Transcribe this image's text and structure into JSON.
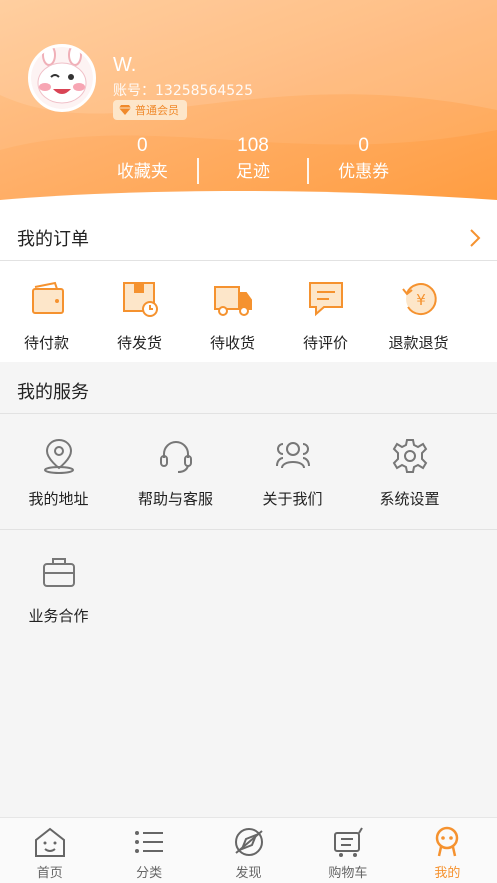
{
  "profile": {
    "username": "W.",
    "account": "账号：13258564525",
    "member_badge": "普通会员"
  },
  "stats": [
    {
      "value": "0",
      "label": "收藏夹"
    },
    {
      "value": "108",
      "label": "足迹"
    },
    {
      "value": "0",
      "label": "优惠券"
    }
  ],
  "orders": {
    "title": "我的订单",
    "items": [
      {
        "label": "待付款",
        "icon": "wallet-icon"
      },
      {
        "label": "待发货",
        "icon": "package-clock-icon"
      },
      {
        "label": "待收货",
        "icon": "truck-icon"
      },
      {
        "label": "待评价",
        "icon": "comment-icon"
      },
      {
        "label": "退款退货",
        "icon": "refund-icon"
      }
    ]
  },
  "services": {
    "title": "我的服务",
    "items": [
      {
        "label": "我的地址",
        "icon": "location-pin-icon"
      },
      {
        "label": "帮助与客服",
        "icon": "headset-icon"
      },
      {
        "label": "关于我们",
        "icon": "group-icon"
      },
      {
        "label": "系统设置",
        "icon": "gear-icon"
      },
      {
        "label": "业务合作",
        "icon": "briefcase-icon"
      }
    ]
  },
  "tabbar": {
    "items": [
      {
        "label": "首页",
        "icon": "home-icon"
      },
      {
        "label": "分类",
        "icon": "list-icon"
      },
      {
        "label": "发现",
        "icon": "compass-icon"
      },
      {
        "label": "购物车",
        "icon": "cart-icon"
      },
      {
        "label": "我的",
        "icon": "profile-icon",
        "active": true
      }
    ]
  },
  "colors": {
    "accent": "#f5922f",
    "header_gradient_start": "#ffc48a",
    "header_gradient_end": "#ff9c3f"
  }
}
